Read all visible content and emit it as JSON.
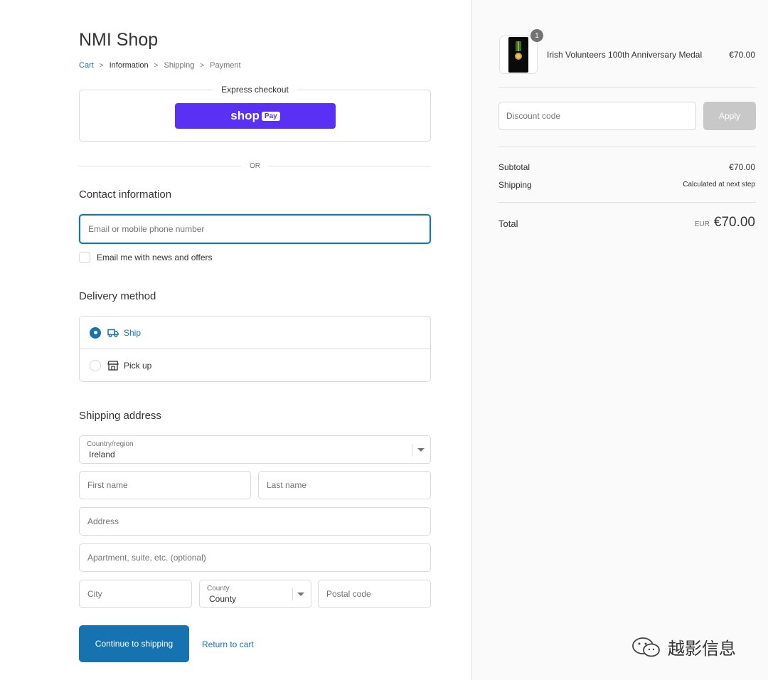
{
  "shop": {
    "title": "NMI Shop"
  },
  "breadcrumb": [
    {
      "label": "Cart"
    },
    {
      "label": "Information"
    },
    {
      "label": "Shipping"
    },
    {
      "label": "Payment"
    }
  ],
  "express": {
    "label": "Express checkout",
    "shoppay_label": "shop",
    "shoppay_badge": "Pay"
  },
  "or_text": "OR",
  "contact": {
    "title": "Contact information",
    "email_placeholder": "Email or mobile phone number",
    "newsletter_label": "Email me with news and offers"
  },
  "delivery": {
    "title": "Delivery method",
    "options": [
      {
        "label": "Ship",
        "icon": "truck-icon",
        "selected": true
      },
      {
        "label": "Pick up",
        "icon": "store-icon",
        "selected": false
      }
    ]
  },
  "shipping": {
    "title": "Shipping address",
    "country_label": "Country/region",
    "country_value": "Ireland",
    "first_name_placeholder": "First name",
    "last_name_placeholder": "Last name",
    "address_placeholder": "Address",
    "apartment_placeholder": "Apartment, suite, etc. (optional)",
    "city_placeholder": "City",
    "county_label": "County",
    "county_value": "County",
    "postal_placeholder": "Postal code"
  },
  "actions": {
    "continue_label": "Continue to shipping",
    "return_label": "Return to cart"
  },
  "summary": {
    "product_name": "Irish Volunteers 100th Anniversary Medal",
    "product_price": "€70.00",
    "quantity": "1",
    "discount_placeholder": "Discount code",
    "apply_label": "Apply",
    "subtotal_label": "Subtotal",
    "subtotal_value": "€70.00",
    "shipping_label": "Shipping",
    "shipping_value": "Calculated at next step",
    "total_label": "Total",
    "total_currency": "EUR",
    "total_value": "€70.00"
  },
  "watermark": {
    "text": "越影信息"
  },
  "colors": {
    "accent": "#1773b0",
    "shoppay": "#5a31f4",
    "apply_disabled": "#c8c8c8"
  }
}
